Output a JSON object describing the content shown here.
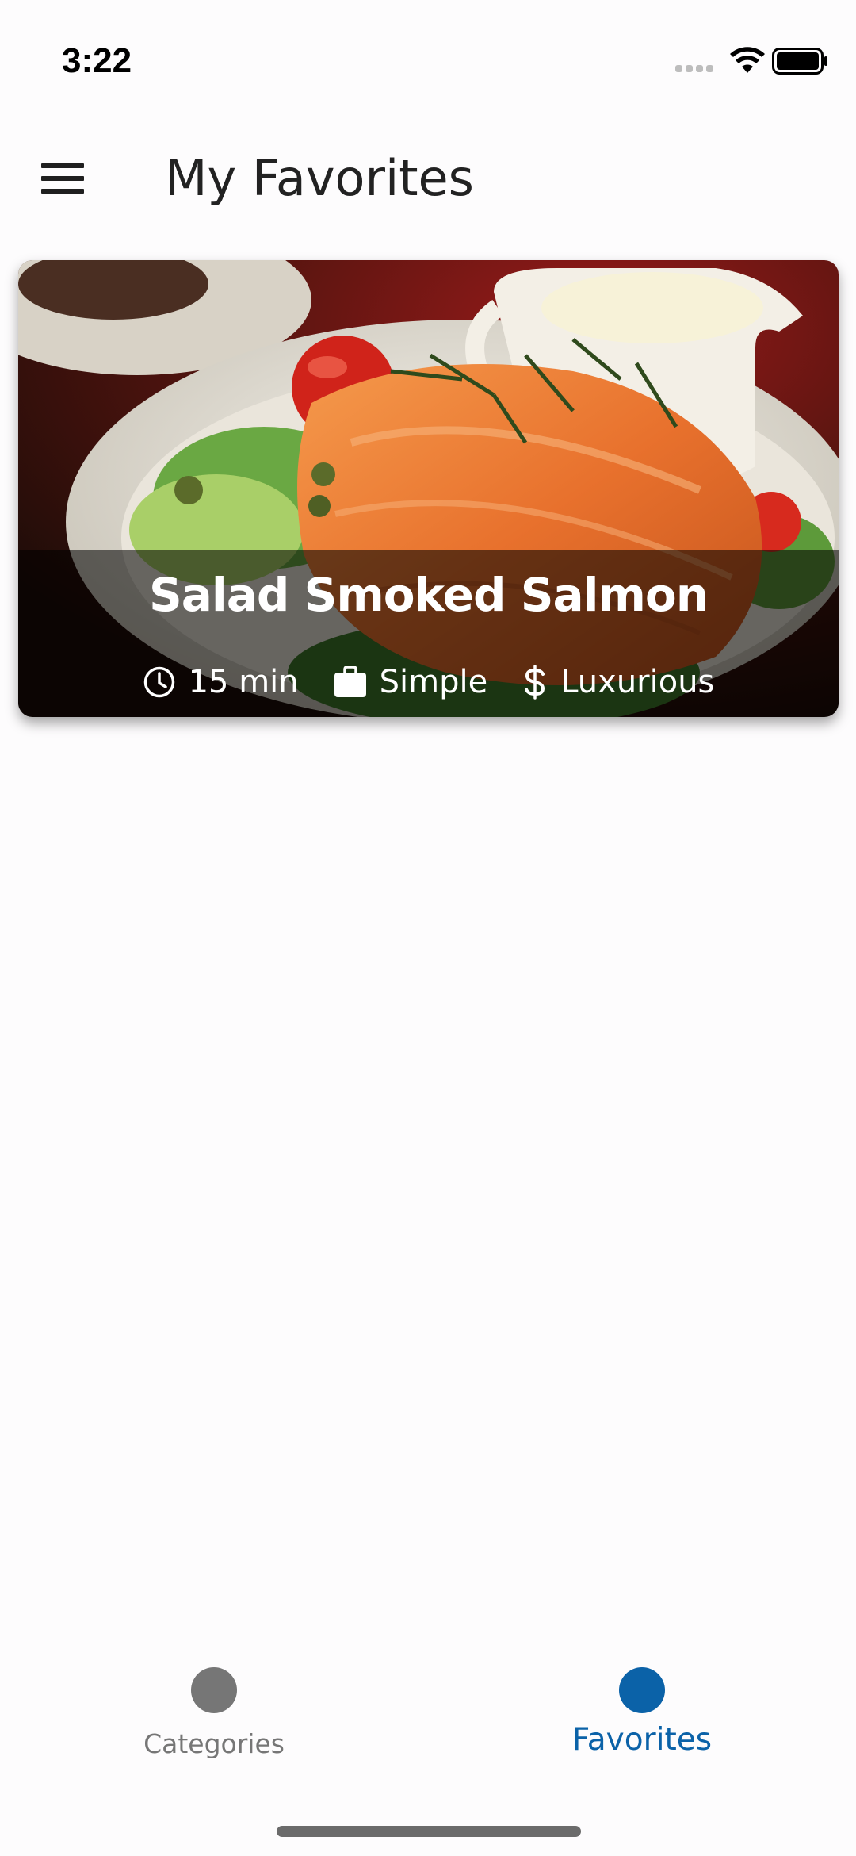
{
  "status_bar": {
    "time": "3:22"
  },
  "header": {
    "title": "My Favorites",
    "menu_icon": "hamburger-menu-icon"
  },
  "favorites": [
    {
      "title": "Salad Smoked Salmon",
      "duration": "15 min",
      "complexity": "Simple",
      "affordability": "Luxurious",
      "icons": [
        "clock-icon",
        "briefcase-icon",
        "dollar-icon"
      ]
    }
  ],
  "tabs": [
    {
      "label": "Categories",
      "active": false,
      "color": "#767676"
    },
    {
      "label": "Favorites",
      "active": true,
      "color": "#0b62a8"
    }
  ],
  "colors": {
    "accent": "#0b62a8",
    "inactive": "#767676",
    "background": "#fdfcfd"
  }
}
